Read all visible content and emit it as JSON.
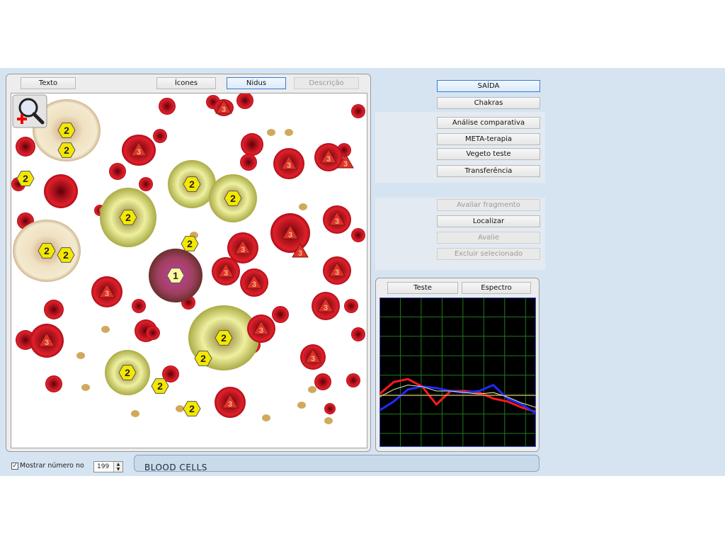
{
  "left_panel": {
    "buttons": {
      "texto": "Texto",
      "icones": "Ícones",
      "nidus": "Nidus",
      "descricao": "Descrição"
    }
  },
  "viewer": {
    "cells": [
      {
        "kind": "white",
        "label": "2"
      },
      {
        "kind": "white",
        "label": "2"
      },
      {
        "kind": "white",
        "label": "2"
      },
      {
        "kind": "white",
        "label": "2"
      },
      {
        "kind": "white",
        "label": "2"
      },
      {
        "kind": "white",
        "label": "2"
      },
      {
        "kind": "white",
        "label": "2"
      },
      {
        "kind": "white",
        "label": "2"
      },
      {
        "kind": "white",
        "label": "2"
      },
      {
        "kind": "white",
        "label": "2"
      },
      {
        "kind": "white",
        "label": "2"
      },
      {
        "kind": "white",
        "label": "2"
      },
      {
        "kind": "white",
        "label": "2"
      },
      {
        "kind": "white",
        "label": "2"
      },
      {
        "kind": "purple",
        "label": "1"
      },
      {
        "kind": "red",
        "label": "3"
      },
      {
        "kind": "red",
        "label": "3"
      },
      {
        "kind": "red",
        "label": "3"
      },
      {
        "kind": "red",
        "label": "3"
      },
      {
        "kind": "red",
        "label": "3"
      },
      {
        "kind": "red",
        "label": "3"
      },
      {
        "kind": "red",
        "label": "3"
      },
      {
        "kind": "red",
        "label": "3"
      },
      {
        "kind": "red",
        "label": "3"
      },
      {
        "kind": "red",
        "label": "3"
      },
      {
        "kind": "red",
        "label": "3"
      },
      {
        "kind": "red",
        "label": "3"
      },
      {
        "kind": "red",
        "label": "3"
      },
      {
        "kind": "red",
        "label": "3"
      },
      {
        "kind": "red",
        "label": "3"
      },
      {
        "kind": "red",
        "label": "3"
      },
      {
        "kind": "red",
        "label": "3"
      },
      {
        "kind": "red",
        "label": "3"
      }
    ]
  },
  "right_panel": {
    "saida": "SAÍDA",
    "chakras": "Chakras",
    "group1": [
      "Análise comparativa",
      "META-terapia",
      "Vegeto teste",
      "Transferência"
    ],
    "group2": [
      {
        "label": "Avaliar fragmento",
        "enabled": false
      },
      {
        "label": "Localizar",
        "enabled": true
      },
      {
        "label": "Avalie",
        "enabled": false
      },
      {
        "label": "Excluir selecionado",
        "enabled": false
      }
    ]
  },
  "graph_panel": {
    "teste": "Teste",
    "espectro": "Espectro",
    "chart_data": {
      "type": "line",
      "x": [
        0,
        1,
        2,
        3,
        4,
        5,
        6,
        7,
        8,
        9,
        10,
        11
      ],
      "series": [
        {
          "color": "#ff1a1a",
          "values": [
            0.25,
            0.33,
            0.35,
            0.3,
            0.18,
            0.27,
            0.27,
            0.26,
            0.22,
            0.2,
            0.16,
            0.13
          ]
        },
        {
          "color": "#1f2bff",
          "values": [
            0.14,
            0.2,
            0.28,
            0.3,
            0.29,
            0.27,
            0.26,
            0.27,
            0.31,
            0.22,
            0.18,
            0.12
          ]
        },
        {
          "color": "#e8e8b0",
          "values": [
            0.23,
            0.28,
            0.31,
            0.3,
            0.27,
            0.27,
            0.26,
            0.25,
            0.26,
            0.23,
            0.19,
            0.16
          ]
        },
        {
          "color": "#ffa07a",
          "values": [
            0.24,
            0.24,
            0.24,
            0.24,
            0.24,
            0.24,
            0.24,
            0.24,
            0.24,
            0.24,
            0.24,
            0.24
          ]
        }
      ],
      "ylim": [
        0,
        1
      ],
      "grid": true,
      "background": "#000000",
      "grid_color": "#1e7a1e"
    }
  },
  "bottom": {
    "checkbox_label": "Mostrar número no marc",
    "checkbox_checked": "✓",
    "spinner_value": "199",
    "spinner_up": "▲",
    "spinner_down": "▼",
    "status_text": "BLOOD  CELLS"
  },
  "colors": {
    "background": "#d6e4f2",
    "marker_white": "#f5e800",
    "marker_red": "#e0302a"
  }
}
